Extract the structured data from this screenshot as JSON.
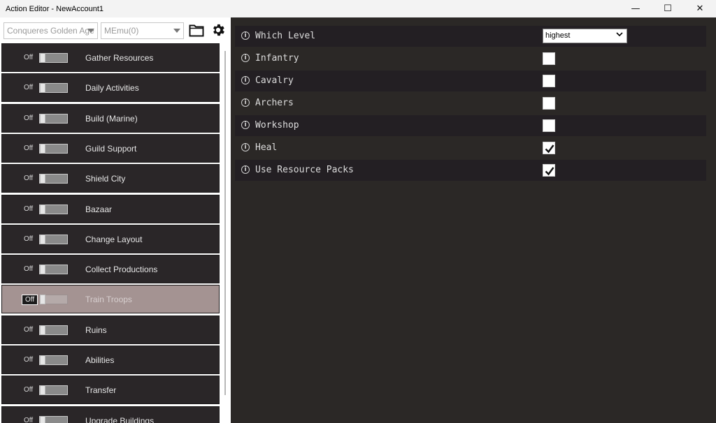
{
  "window": {
    "title": "Action Editor - NewAccount1",
    "minimize": "—",
    "maximize": "☐",
    "close": "✕"
  },
  "toolbar": {
    "game_combo": "Conqueres Golden Age",
    "emulator_combo": "MEmu(0)",
    "folder_icon": "folder-icon",
    "gear_icon": "gear-icon"
  },
  "actions": [
    {
      "label": "Gather Resources",
      "state": "Off",
      "selected": false
    },
    {
      "label": "Daily Activities",
      "state": "Off",
      "selected": false
    },
    {
      "label": "Build (Marine)",
      "state": "Off",
      "selected": false
    },
    {
      "label": "Guild Support",
      "state": "Off",
      "selected": false
    },
    {
      "label": "Shield City",
      "state": "Off",
      "selected": false
    },
    {
      "label": "Bazaar",
      "state": "Off",
      "selected": false
    },
    {
      "label": "Change Layout",
      "state": "Off",
      "selected": false
    },
    {
      "label": "Collect Productions",
      "state": "Off",
      "selected": false
    },
    {
      "label": "Train Troops",
      "state": "Off",
      "selected": true
    },
    {
      "label": "Ruins",
      "state": "Off",
      "selected": false
    },
    {
      "label": "Abilities",
      "state": "Off",
      "selected": false
    },
    {
      "label": "Transfer",
      "state": "Off",
      "selected": false
    },
    {
      "label": "Upgrade Buildings",
      "state": "Off",
      "selected": false
    }
  ],
  "settings": [
    {
      "label": "Which Level",
      "type": "select",
      "value": "highest"
    },
    {
      "label": "Infantry",
      "type": "checkbox",
      "checked": false
    },
    {
      "label": "Cavalry",
      "type": "checkbox",
      "checked": false
    },
    {
      "label": "Archers",
      "type": "checkbox",
      "checked": false
    },
    {
      "label": "Workshop",
      "type": "checkbox",
      "checked": false
    },
    {
      "label": "Heal",
      "type": "checkbox",
      "checked": true
    },
    {
      "label": "Use Resource Packs",
      "type": "checkbox",
      "checked": true
    }
  ],
  "info_glyph": "i",
  "colors": {
    "background": "#2b2826",
    "list_item": "#2a2628",
    "selected_item": "#a49392",
    "row_alt": "#231f23"
  }
}
